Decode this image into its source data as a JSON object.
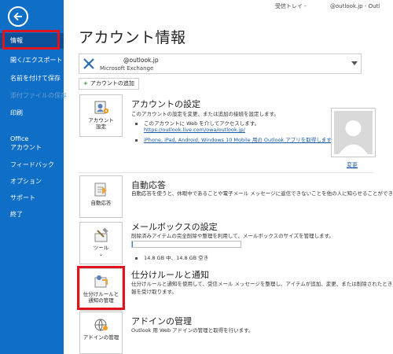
{
  "window": {
    "topbar_text": "受信トレイ -     @outlook.jp  -  Outl"
  },
  "sidebar": {
    "items": [
      {
        "label": "情報",
        "state": "active"
      },
      {
        "label": "開く/エクスポート",
        "state": "normal"
      },
      {
        "label": "名前を付けて保存",
        "state": "normal"
      },
      {
        "label": "添付ファイルの保存",
        "state": "disabled"
      },
      {
        "label": "印刷",
        "state": "normal"
      },
      {
        "label": "Office",
        "state": "normal"
      },
      {
        "label": "アカウント",
        "state": "normal"
      },
      {
        "label": "フィードバック",
        "state": "normal"
      },
      {
        "label": "オプション",
        "state": "normal"
      },
      {
        "label": "サポート",
        "state": "normal"
      },
      {
        "label": "終了",
        "state": "normal"
      }
    ]
  },
  "page": {
    "title": "アカウント情報"
  },
  "account": {
    "email": "    @outlook.jp",
    "type": "Microsoft Exchange",
    "add_account_label": "アカウントの追加"
  },
  "sections": {
    "account_settings": {
      "tile_label_1": "アカウント",
      "tile_label_2": "設定",
      "title": "アカウントの設定",
      "desc": "このアカウントの設定を変更、または追加の接続を設定します。",
      "bullet_1": "このアカウントに Web を介してアクセスします。",
      "bullet_1_link": "https://outlook.live.com/owa/outlook.jp/",
      "bullet_2_link": "iPhone, iPad, Android, Windows 10 Mobile 用の Outlook アプリを取得します。",
      "change_label": "変更"
    },
    "auto_reply": {
      "tile_label": "自動応答",
      "title": "自動応答",
      "desc": "自動応答を使うと、休暇中であることや電子メール メッセージに返信できないことを他の人に知らせることができます。"
    },
    "mailbox": {
      "tile_label": "ツール",
      "title": "メールボックスの設定",
      "desc": "削除済みアイテムの完全削除や整理を利用して、メールボックスのサイズを管理します。",
      "usage_text": "14.8 GB 中、14.8 GB 空き",
      "used_fraction": 0.01
    },
    "rules": {
      "tile_label_1": "仕分けルールと",
      "tile_label_2": "通知の管理",
      "title": "仕分けルールと通知",
      "desc_1": "仕分けルールと通知を使用して、受信メール メッセージを整理し、アイテムが追加、変更、または削除されたときに更新情",
      "desc_2": "報を受け取ります。"
    },
    "addins": {
      "tile_label": "アドインの管理",
      "title": "アドインの管理",
      "desc": "Outlook 用 Web アドインの管理と取得を行います。"
    }
  },
  "colors": {
    "sidebar": "#0f6ec6",
    "highlight": "#e0141e",
    "link": "#1a5aa8"
  }
}
